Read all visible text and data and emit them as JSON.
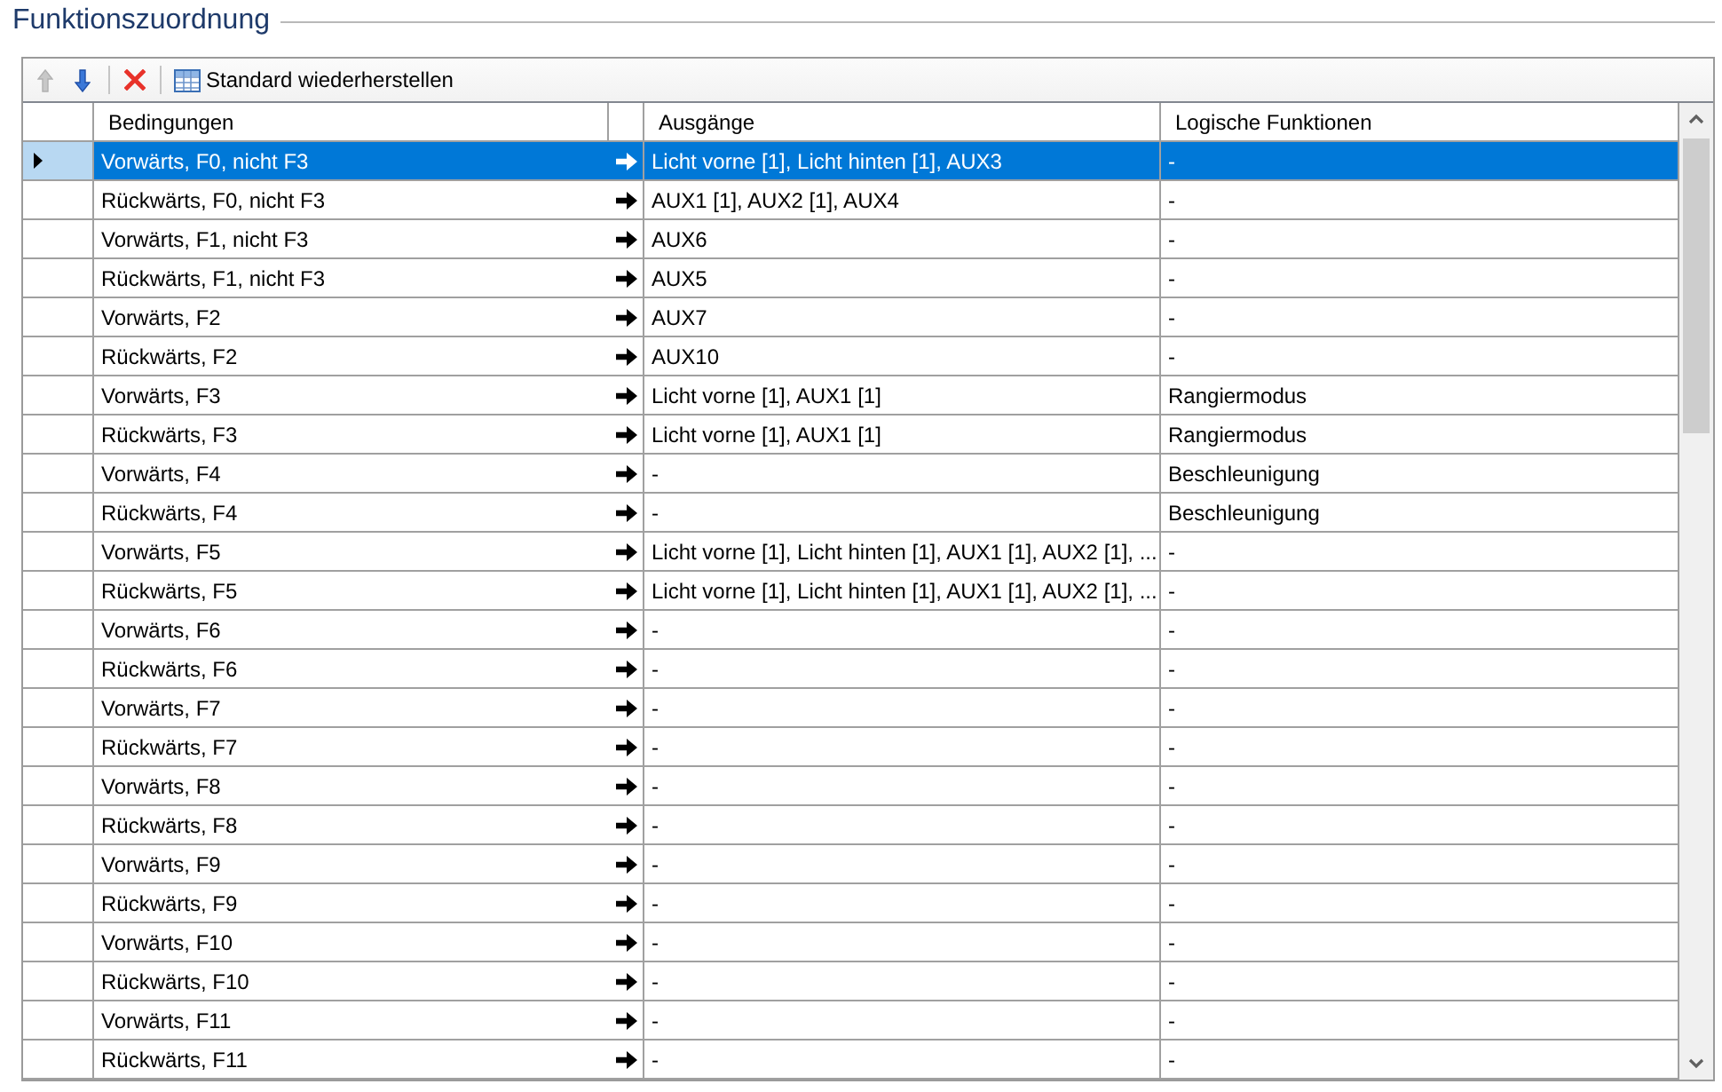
{
  "group": {
    "title": "Funktionszuordnung"
  },
  "toolbar": {
    "items": [
      {
        "kind": "move-up",
        "disabled": true
      },
      {
        "kind": "move-down",
        "disabled": false
      },
      {
        "kind": "separator"
      },
      {
        "kind": "delete",
        "disabled": false
      },
      {
        "kind": "separator"
      },
      {
        "kind": "restore",
        "label": "Standard wiederherstellen",
        "disabled": false
      }
    ]
  },
  "table": {
    "columns": [
      "Bedingungen",
      "Ausgänge",
      "Logische Funktionen"
    ],
    "rows": [
      {
        "selected": true,
        "bedingungen": "Vorwärts, F0, nicht F3",
        "ausgaenge": "Licht vorne [1], Licht hinten [1], AUX3",
        "logische_funktionen": "-"
      },
      {
        "selected": false,
        "bedingungen": "Rückwärts, F0, nicht F3",
        "ausgaenge": "AUX1 [1], AUX2 [1], AUX4",
        "logische_funktionen": "-"
      },
      {
        "selected": false,
        "bedingungen": "Vorwärts, F1, nicht F3",
        "ausgaenge": "AUX6",
        "logische_funktionen": "-"
      },
      {
        "selected": false,
        "bedingungen": "Rückwärts, F1, nicht F3",
        "ausgaenge": "AUX5",
        "logische_funktionen": "-"
      },
      {
        "selected": false,
        "bedingungen": "Vorwärts, F2",
        "ausgaenge": "AUX7",
        "logische_funktionen": "-"
      },
      {
        "selected": false,
        "bedingungen": "Rückwärts, F2",
        "ausgaenge": "AUX10",
        "logische_funktionen": "-"
      },
      {
        "selected": false,
        "bedingungen": "Vorwärts, F3",
        "ausgaenge": "Licht vorne [1], AUX1 [1]",
        "logische_funktionen": "Rangiermodus"
      },
      {
        "selected": false,
        "bedingungen": "Rückwärts, F3",
        "ausgaenge": "Licht vorne [1], AUX1 [1]",
        "logische_funktionen": "Rangiermodus"
      },
      {
        "selected": false,
        "bedingungen": "Vorwärts, F4",
        "ausgaenge": "-",
        "logische_funktionen": "Beschleunigung"
      },
      {
        "selected": false,
        "bedingungen": "Rückwärts, F4",
        "ausgaenge": "-",
        "logische_funktionen": "Beschleunigung"
      },
      {
        "selected": false,
        "bedingungen": "Vorwärts, F5",
        "ausgaenge": "Licht vorne [1], Licht hinten [1], AUX1 [1], AUX2 [1], ...",
        "logische_funktionen": "-"
      },
      {
        "selected": false,
        "bedingungen": "Rückwärts, F5",
        "ausgaenge": "Licht vorne [1], Licht hinten [1], AUX1 [1], AUX2 [1], ...",
        "logische_funktionen": "-"
      },
      {
        "selected": false,
        "bedingungen": "Vorwärts, F6",
        "ausgaenge": "-",
        "logische_funktionen": "-"
      },
      {
        "selected": false,
        "bedingungen": "Rückwärts, F6",
        "ausgaenge": "-",
        "logische_funktionen": "-"
      },
      {
        "selected": false,
        "bedingungen": "Vorwärts, F7",
        "ausgaenge": "-",
        "logische_funktionen": "-"
      },
      {
        "selected": false,
        "bedingungen": "Rückwärts, F7",
        "ausgaenge": "-",
        "logische_funktionen": "-"
      },
      {
        "selected": false,
        "bedingungen": "Vorwärts, F8",
        "ausgaenge": "-",
        "logische_funktionen": "-"
      },
      {
        "selected": false,
        "bedingungen": "Rückwärts, F8",
        "ausgaenge": "-",
        "logische_funktionen": "-"
      },
      {
        "selected": false,
        "bedingungen": "Vorwärts, F9",
        "ausgaenge": "-",
        "logische_funktionen": "-"
      },
      {
        "selected": false,
        "bedingungen": "Rückwärts, F9",
        "ausgaenge": "-",
        "logische_funktionen": "-"
      },
      {
        "selected": false,
        "bedingungen": "Vorwärts, F10",
        "ausgaenge": "-",
        "logische_funktionen": "-"
      },
      {
        "selected": false,
        "bedingungen": "Rückwärts, F10",
        "ausgaenge": "-",
        "logische_funktionen": "-"
      },
      {
        "selected": false,
        "bedingungen": "Vorwärts, F11",
        "ausgaenge": "-",
        "logische_funktionen": "-"
      },
      {
        "selected": false,
        "bedingungen": "Rückwärts, F11",
        "ausgaenge": "-",
        "logische_funktionen": "-"
      }
    ]
  }
}
